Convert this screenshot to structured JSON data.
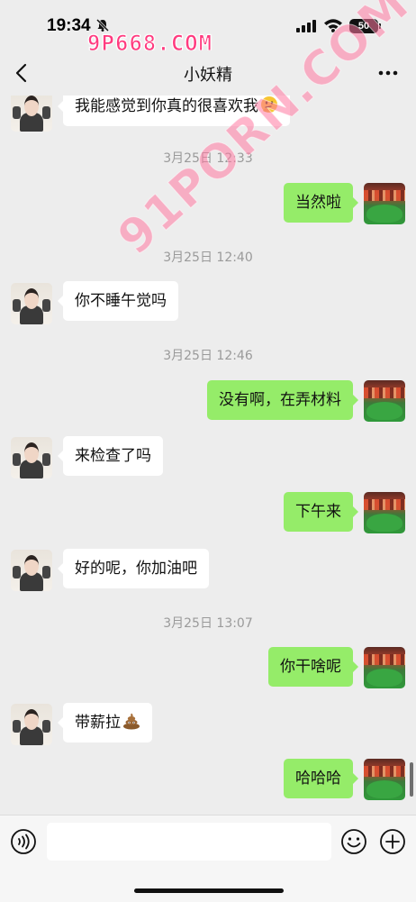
{
  "status_bar": {
    "time": "19:34",
    "battery": "50"
  },
  "watermarks": {
    "top": "9P668.COM",
    "diagonal": "91PORN.COM"
  },
  "header": {
    "title": "小妖精"
  },
  "messages": [
    {
      "type": "message",
      "sender": "her",
      "text": "我能感觉到你真的很喜欢我",
      "emoji": "thinking-face"
    },
    {
      "type": "timestamp",
      "text": "3月25日 12:33"
    },
    {
      "type": "message",
      "sender": "me",
      "text": "当然啦"
    },
    {
      "type": "timestamp",
      "text": "3月25日 12:40"
    },
    {
      "type": "message",
      "sender": "her",
      "text": "你不睡午觉吗"
    },
    {
      "type": "timestamp",
      "text": "3月25日 12:46"
    },
    {
      "type": "message",
      "sender": "me",
      "text": "没有啊，在弄材料"
    },
    {
      "type": "message",
      "sender": "her",
      "text": "来检查了吗"
    },
    {
      "type": "message",
      "sender": "me",
      "text": "下午来"
    },
    {
      "type": "message",
      "sender": "her",
      "text": "好的呢，你加油吧"
    },
    {
      "type": "timestamp",
      "text": "3月25日 13:07"
    },
    {
      "type": "message",
      "sender": "me",
      "text": "你干啥呢"
    },
    {
      "type": "message",
      "sender": "her",
      "text": "带薪拉",
      "emoji": "pile-of-poo"
    },
    {
      "type": "message",
      "sender": "me",
      "text": "哈哈哈"
    }
  ],
  "input_bar": {
    "value": "",
    "placeholder": ""
  },
  "colors": {
    "background": "#ededed",
    "bubble_sent": "#95ec69",
    "bubble_received": "#ffffff",
    "timestamp": "#9a9a9a"
  }
}
